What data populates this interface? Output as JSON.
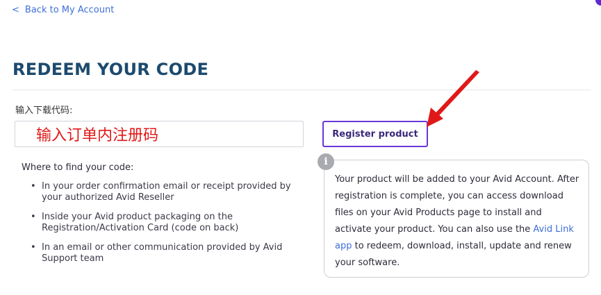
{
  "nav": {
    "back_label": "Back to My Account",
    "back_chevron": "<"
  },
  "page_title": "REDEEM YOUR CODE",
  "form": {
    "field_label": "输入下载代码:",
    "input_value": "输入订单内注册码",
    "register_label": "Register product"
  },
  "help": {
    "heading": "Where to find your code:",
    "items": [
      "In your order confirmation email or receipt provided by your authorized Avid Reseller",
      "Inside your Avid product packaging on the Registration/Activation Card (code on back)",
      "In an email or other communication provided by Avid Support team"
    ]
  },
  "info": {
    "icon_glyph": "i",
    "text_before": "Your product will be added to your Avid Account. After registration is complete, you can access download files on your Avid Products page to install and activate your product. You can also use the ",
    "link_label": "Avid Link app",
    "text_after": " to redeem, download, install, update and renew your software."
  },
  "colors": {
    "accent": "#6b35d9",
    "link": "#3d6fd8",
    "title": "#1d4a6e",
    "annotation": "#e01818"
  },
  "icons": {
    "back": "chevron-left-icon",
    "info": "info-icon",
    "annotation": "red-arrow-annotation"
  }
}
